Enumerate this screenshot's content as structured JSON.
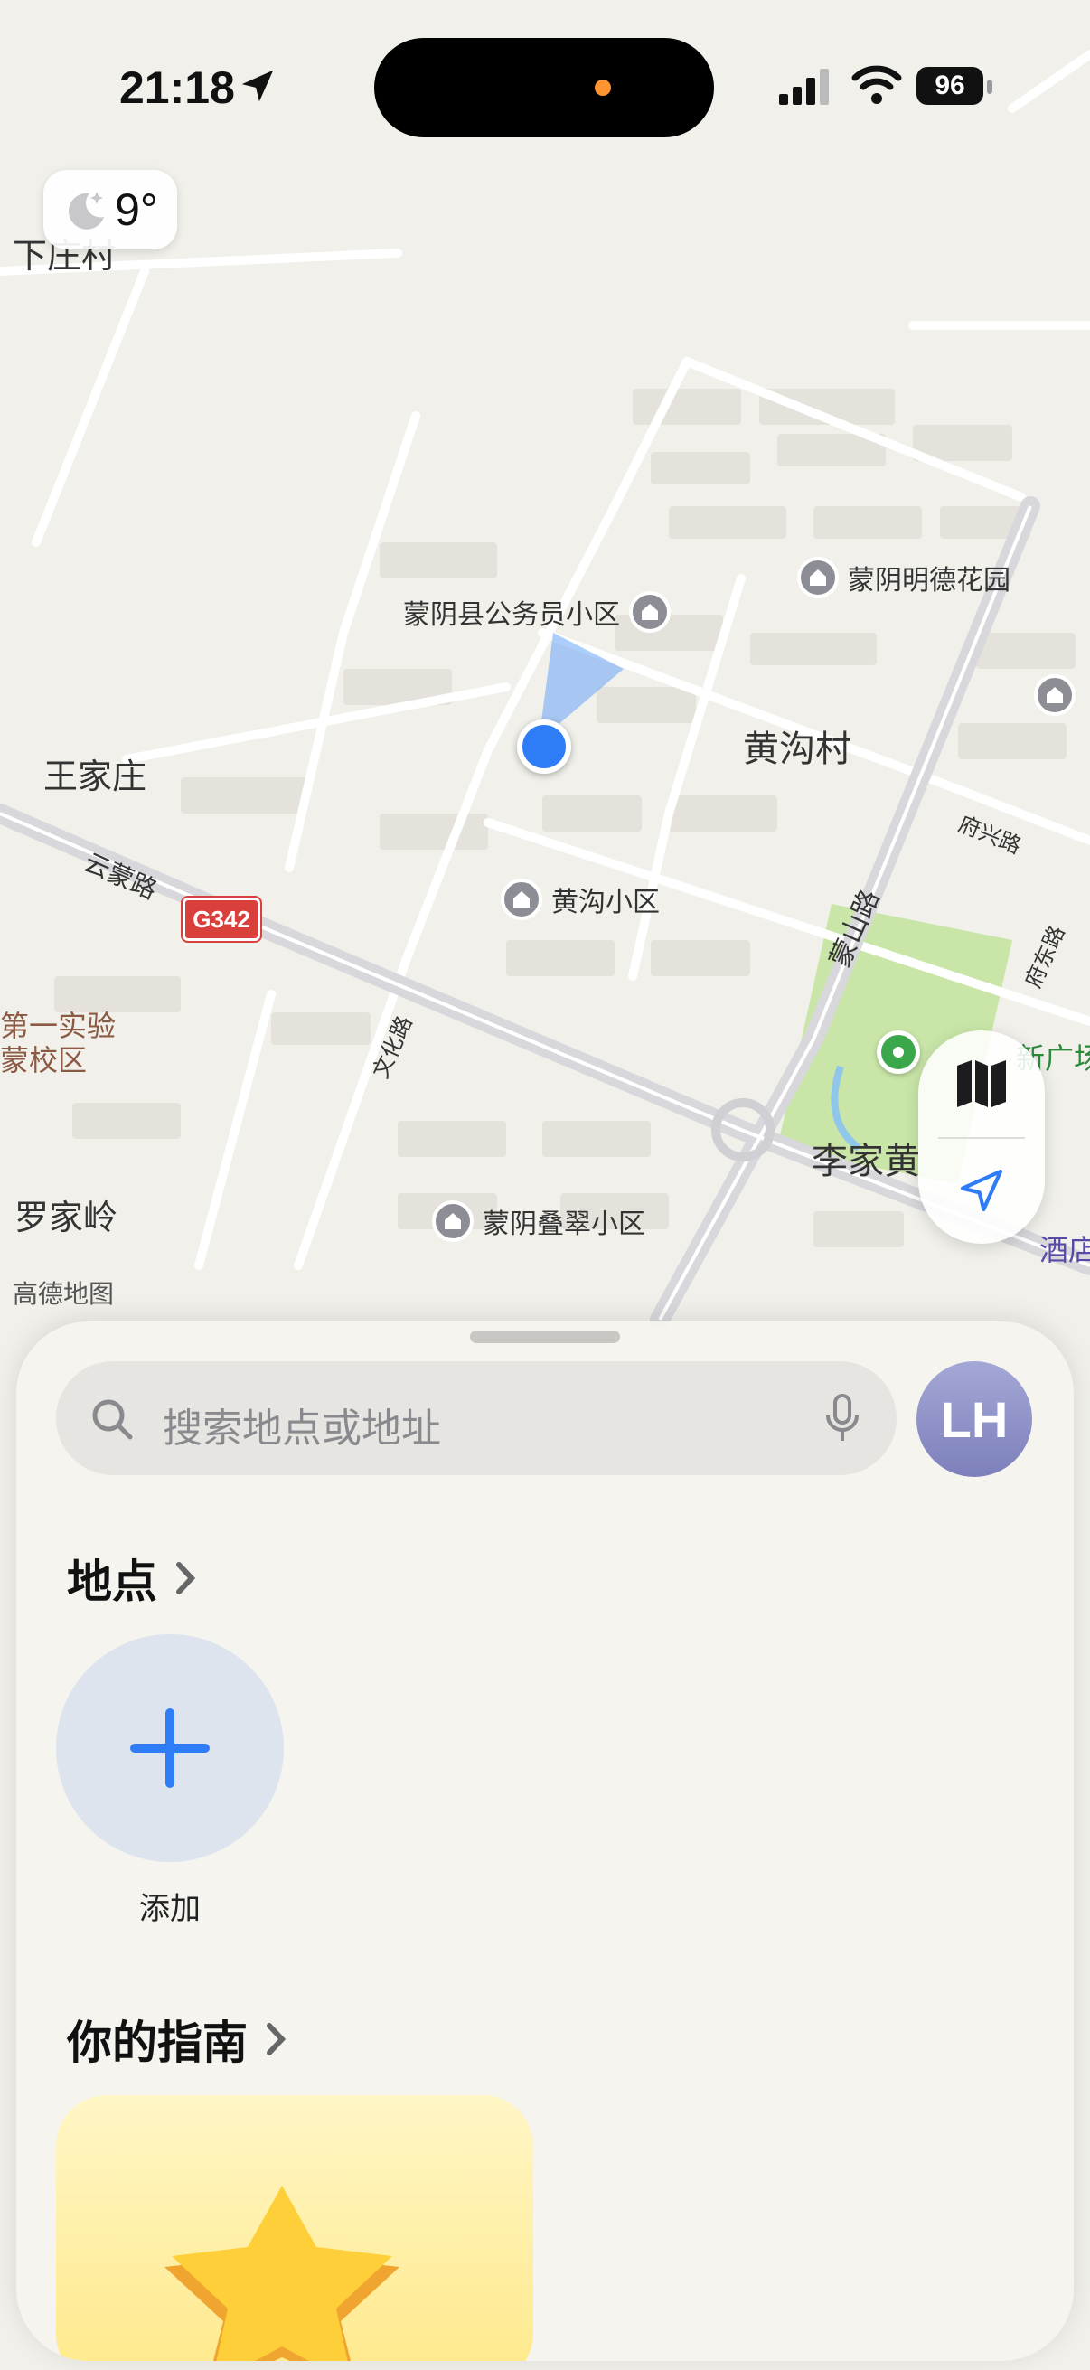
{
  "status_bar": {
    "time": "21:18",
    "battery": "96"
  },
  "weather": {
    "temperature": "9°",
    "icon": "moon-icon"
  },
  "map": {
    "labels": {
      "xiazhuang": "下庄村",
      "wangjiazhuang": "王家庄",
      "yunmeng_road": "云蒙路",
      "huanggou_village": "黄沟村",
      "fuxing_road": "府兴路",
      "mengshan_road": "蒙山路",
      "fudong_road": "府东路",
      "wenhua_road": "文化路",
      "school": "第一实验\n蒙校区",
      "luojialing": "罗家岭",
      "lijia": "李家黄",
      "xinguang": "新广场",
      "hotel": "酒店",
      "attribution": "高德地图"
    },
    "pois": {
      "civil_servant": "蒙阴县公务员小区",
      "mingde": "蒙阴明德花园",
      "huanggou_district": "黄沟小区",
      "diecui": "蒙阴叠翠小区"
    },
    "road_shield": "G342",
    "colors": {
      "location": "#2f7df6",
      "park": "#c9e6a8",
      "road_shield": "#d9403c"
    }
  },
  "controls": {
    "map_mode": "map-icon",
    "locate": "location-arrow-icon"
  },
  "sheet": {
    "search_placeholder": "搜索地点或地址",
    "avatar_initials": "LH",
    "places_title": "地点",
    "add_label": "添加",
    "guides_title": "你的指南"
  }
}
